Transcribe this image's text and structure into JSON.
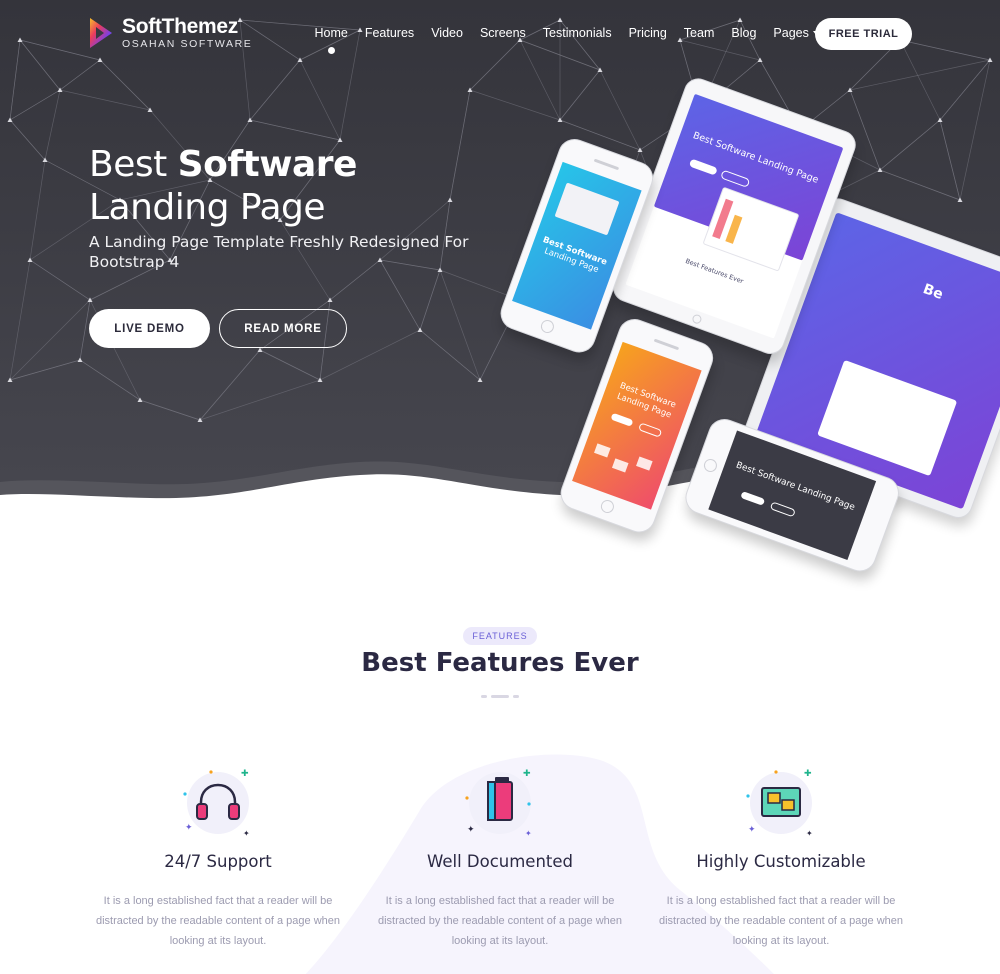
{
  "brand": {
    "name": "SoftThemez",
    "tagline": "OSAHAN SOFTWARE"
  },
  "nav": {
    "items": [
      "Home",
      "Features",
      "Video",
      "Screens",
      "Testimonials",
      "Pricing",
      "Team",
      "Blog",
      "Pages"
    ],
    "active": "Home",
    "cta_label": "FREE TRIAL"
  },
  "hero": {
    "title_prefix": "Best ",
    "title_bold": "Software",
    "title_line2": "Landing Page",
    "subtitle": "A Landing Page Template Freshly Redesigned For Bootstrap 4",
    "primary_button": "LIVE DEMO",
    "secondary_button": "READ MORE"
  },
  "mockups": {
    "screen_title_prefix": "Best ",
    "screen_title_bold": "Software",
    "screen_title_line2": "Landing Page",
    "screen_features": "Best Features Ever",
    "brand": "SoftThemez"
  },
  "features": {
    "badge": "FEATURES",
    "title": "Best Features Ever",
    "items": [
      {
        "title": "24/7 Support",
        "text": "It is a long established fact that a reader will be distracted by the readable content of a page when looking at its layout.",
        "icon": "headphones-icon"
      },
      {
        "title": "Well Documented",
        "text": "It is a long established fact that a reader will be distracted by the readable content of a page when looking at its layout.",
        "icon": "book-icon"
      },
      {
        "title": "Highly Customizable",
        "text": "It is a long established fact that a reader will be distracted by the readable content of a page when looking at its layout.",
        "icon": "layout-icon"
      }
    ]
  },
  "colors": {
    "hero_bg": "#3a3a42",
    "accent_purple": "#6a5fd6",
    "heading": "#2b2943",
    "body_text": "#9c9bb0"
  }
}
